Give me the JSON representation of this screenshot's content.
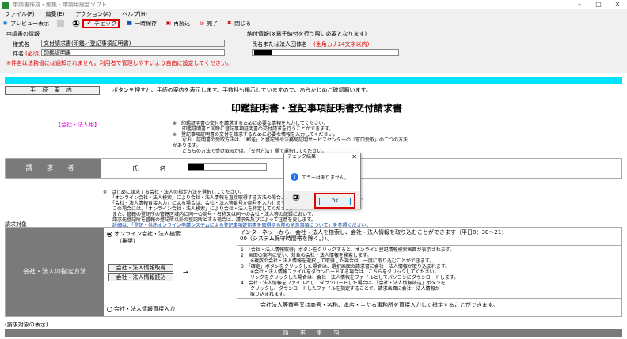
{
  "window": {
    "title": "申請書作成・編集 - 申請用総合ソフト",
    "min": "–",
    "max": "□",
    "close": "✕"
  },
  "menu": [
    "ファイル(F)",
    "編集(E)",
    "アクション(A)",
    "ヘルプ(H)"
  ],
  "toolbar": {
    "preview": "プレビュー表示",
    "marker1": "①",
    "check": "チェック",
    "save_draft": "一時保存",
    "reload": "再読込",
    "finish": "完了",
    "close": "閉じる"
  },
  "request_info": {
    "section_title": "申請書の情報",
    "form_name_label": "様式名",
    "form_name_value": "交付請求書(印鑑／登記事項証明書)",
    "subject_label": "件名",
    "required_mark": "(必須)",
    "subject_value": "印鑑証明書",
    "subject_note": "※件名は法務省には通知されません。利用者で管理しやすいよう自由に設定してください。",
    "payment_title": "納付情報(※電子納付を行う際に必要となります)",
    "payer_label": "氏名または法人団体名",
    "payer_hint": "(全角カナ24文字以内)"
  },
  "guide": {
    "button": "手 続 案 内",
    "text": "ボタンを押すと、手続の案内を表示します。手数料も掲示していますので、あらかじめご確認願います。"
  },
  "main": {
    "heading": "印鑑証明書・登記事項証明書交付請求書",
    "corp_tag": "【会社・法人用】",
    "notes": [
      "※　印鑑証明書の交付を請求するために必要な情報を入力してください。",
      "　　印鑑証明書と同時に登記事項証明書の交付請求を行うことができます。",
      "※　登記事項証明書の交付を請求するために必要な情報を入力してください。",
      "　　なお、証明書の受取方法は、「郵送」と登記所や法務局証明サービスセンターの「窓口受取」の二つの方法があります。",
      "　　どちらの方法で受け取るかは、「交付方法」欄で選択してください。"
    ]
  },
  "requester": {
    "label": "請 求 者",
    "name_label": "氏 名"
  },
  "subject": {
    "notes": [
      "※　はじめに請求する会社・法人の指定方法を選択してください。",
      "　　「オンライン会社・法人検索」により会社・法人情報を直接取得する方法の場合、会社・法人情報が自動表示されます。",
      "　　「会社・法人情報直接入力」による場合は、会社・法人等番号か商号を入力します。",
      "　　この場合には、「オンライン会社・法人検索」により会社・法人を特定してください。",
      "　　また、管轄の登記所の管轄区域内に同一の商号・名称又は同一の会社・法人等の記録において、",
      "　　請求先登記所を管轄の登記所以外の登記所とする場合は、請求先及びによって注意を要します。",
      "　　詳細は、「登記・供託オンライン申請システムによる登記事項証明書を取得する際の留意事項について」を参照ください。"
    ],
    "section_label": "請求対象"
  },
  "spec": {
    "label": "会社・法人の指定方法",
    "option_online": "オンライン会社・法人検索",
    "option_online_sub": "（推奨）",
    "online_desc": "インターネットから、会社・法人を検索し、会社・法人情報を取り込むことができます（平日8：30～21：00（システム保守時間帯を除く。））。",
    "btn_get": "会社・法人情報取得",
    "btn_load": "会社・法人情報読込",
    "arrow": "→",
    "steps": [
      "1　「会社・法人情報取得」ボタンをクリックすると、オンライン登記情報検索画面が表示されます。",
      "2　画面の案内に従い、対象の会社・法人情報を検索します。",
      "　　※複数の会社・法人情報を選択して取得した場合は、一度に取り込むことができます。",
      "3　「確定」ボタンをクリックした場合は、選択画面の請求書に会社・法人情報が取り込まれます。",
      "　　※会社・法人情報ファイルをダウンロードする場合は、こちらをクリックしてください。",
      "　　リンクをクリックした場合は、会社・法人情報をファイルとしてパソコンにダウンロードします。",
      "4　会社・法人情報をファイルとしてダウンロードした場合は、「会社・法人情報読込」ボタンを",
      "　　クリックし、ダウンロードしたファイルを指定することで、請求画面に会社・法人情報が",
      "　　取り込まれます。"
    ],
    "option_direct": "会社・法人情報直接入力",
    "direct_desc": "会社法人等番号又は商号・名称、本店・主たる事務所を直接入力して指定することができます。"
  },
  "display": {
    "label": "(請求対象の表示)",
    "bar": "請 求 事 項"
  },
  "dialog": {
    "title": "チェック結果",
    "close": "✕",
    "icon": "i",
    "message": "エラーはありません。",
    "ok": "OK",
    "marker2": "②"
  }
}
